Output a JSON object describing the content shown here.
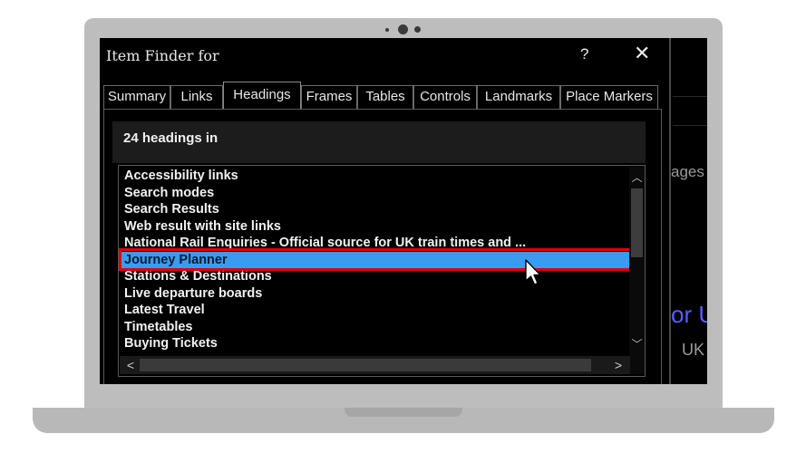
{
  "dialog": {
    "title": "Item Finder for",
    "help_label": "?",
    "close_label": "✕"
  },
  "tabs": [
    {
      "label": "Summary"
    },
    {
      "label": "Links"
    },
    {
      "label": "Headings"
    },
    {
      "label": "Frames"
    },
    {
      "label": "Tables"
    },
    {
      "label": "Controls"
    },
    {
      "label": "Landmarks"
    },
    {
      "label": "Place Markers"
    }
  ],
  "active_tab": "Headings",
  "count_text": "24 headings in",
  "headings": [
    "Accessibility links",
    "Search modes",
    "Search Results",
    "Web result with site links",
    "National Rail Enquiries - Official source for UK train times and ...",
    "Journey Planner",
    "Stations & Destinations",
    "Live departure boards",
    "Latest Travel",
    "Timetables",
    "Buying Tickets"
  ],
  "selected_heading": "Journey Planner",
  "scroll": {
    "up_glyph": "︿",
    "down_glyph": "﹀",
    "left_glyph": "<",
    "right_glyph": ">"
  },
  "background_page": {
    "text_1": "ages",
    "text_2": "or U",
    "text_3": "UK"
  },
  "colors": {
    "selection": "#3a9bf3",
    "highlight_border": "#e0000f",
    "background_link": "#5c5cff"
  }
}
